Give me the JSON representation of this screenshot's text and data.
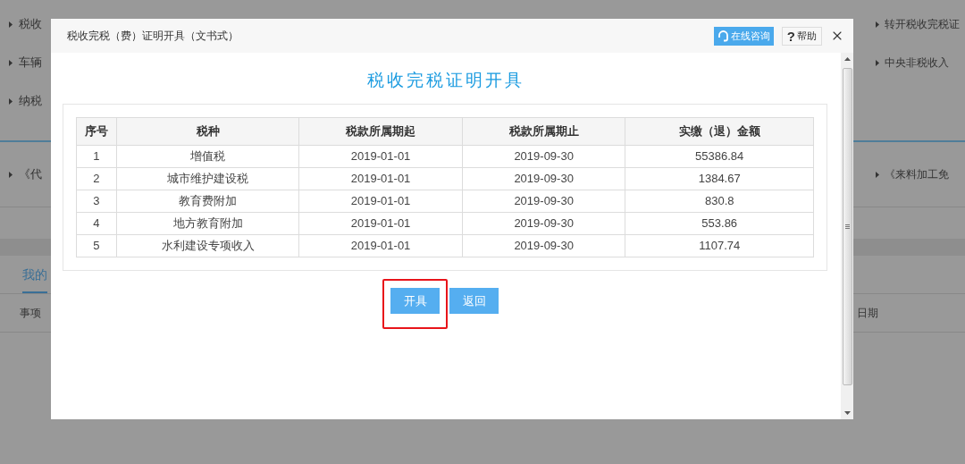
{
  "background": {
    "links_left": [
      "税收",
      "车辆",
      "纳税"
    ],
    "links_right": [
      "转开税收完税证",
      "中央非税收入"
    ],
    "form_left": "《代",
    "form_right": "《来料加工免",
    "tab": "我的",
    "column_left": "事项",
    "column_right": "日期"
  },
  "dialog": {
    "title": "税收完税（费）证明开具（文书式）",
    "consult": "在线咨询",
    "help_mark": "?",
    "help": "帮助",
    "heading": "税收完税证明开具",
    "table": {
      "columns": [
        "序号",
        "税种",
        "税款所属期起",
        "税款所属期止",
        "实缴（退）金额"
      ],
      "rows": [
        [
          "1",
          "增值税",
          "2019-01-01",
          "2019-09-30",
          "55386.84"
        ],
        [
          "2",
          "城市维护建设税",
          "2019-01-01",
          "2019-09-30",
          "1384.67"
        ],
        [
          "3",
          "教育费附加",
          "2019-01-01",
          "2019-09-30",
          "830.8"
        ],
        [
          "4",
          "地方教育附加",
          "2019-01-01",
          "2019-09-30",
          "553.86"
        ],
        [
          "5",
          "水利建设专项收入",
          "2019-01-01",
          "2019-09-30",
          "1107.74"
        ]
      ]
    },
    "actions": [
      {
        "label": "开具",
        "highlighted": true
      },
      {
        "label": "返回",
        "highlighted": false
      }
    ]
  }
}
